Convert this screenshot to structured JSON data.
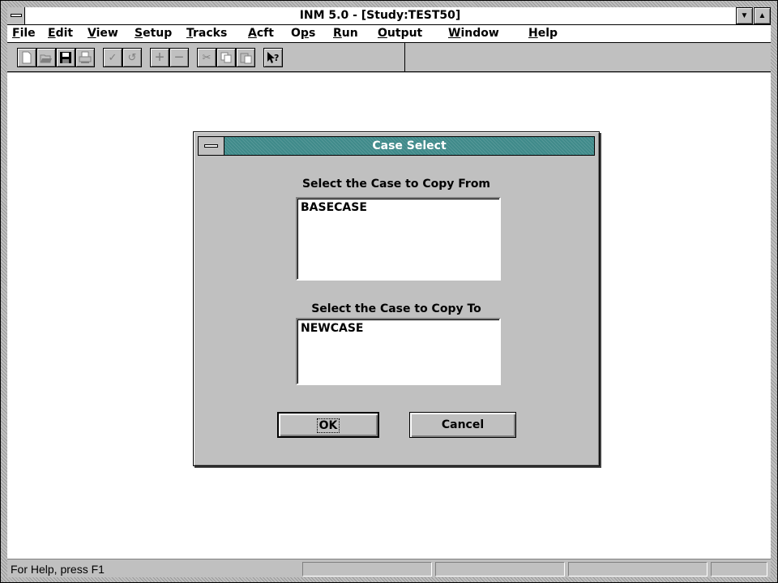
{
  "app": {
    "title": "INM 5.0 - [Study:TEST50]"
  },
  "menu": [
    {
      "label": "File",
      "u": "F",
      "rest": "ile"
    },
    {
      "label": "Edit",
      "u": "E",
      "rest": "dit"
    },
    {
      "label": "View",
      "u": "V",
      "rest": "iew"
    },
    {
      "label": "Setup",
      "u": "S",
      "rest": "etup"
    },
    {
      "label": "Tracks",
      "u": "T",
      "rest": "racks"
    },
    {
      "label": "Acft",
      "u": "A",
      "rest": "cft"
    },
    {
      "label": "Ops",
      "pre": "O",
      "u": "p",
      "rest": "s"
    },
    {
      "label": "Run",
      "u": "R",
      "rest": "un"
    },
    {
      "label": "Output",
      "u": "O",
      "rest": "utput"
    },
    {
      "label": "Window",
      "u": "W",
      "rest": "indow"
    },
    {
      "label": "Help",
      "u": "H",
      "rest": "elp"
    }
  ],
  "toolbar": {
    "buttons": [
      "new-file-icon",
      "open-folder-icon",
      "save-disk-icon",
      "print-icon",
      "check-icon",
      "undo-icon",
      "add-icon",
      "remove-icon",
      "cut-icon",
      "copy-icon",
      "paste-icon",
      "context-help-icon"
    ]
  },
  "dialog": {
    "title": "Case Select",
    "from_label": "Select the Case to Copy From",
    "from_items": [
      "BASECASE"
    ],
    "to_label": "Select the Case to Copy To",
    "to_items": [
      "NEWCASE"
    ],
    "ok_label": "OK",
    "cancel_label": "Cancel"
  },
  "status": {
    "text": "For Help, press F1"
  },
  "colors": {
    "dialog_title": "#3f8a8a",
    "face": "#c0c0c0"
  }
}
